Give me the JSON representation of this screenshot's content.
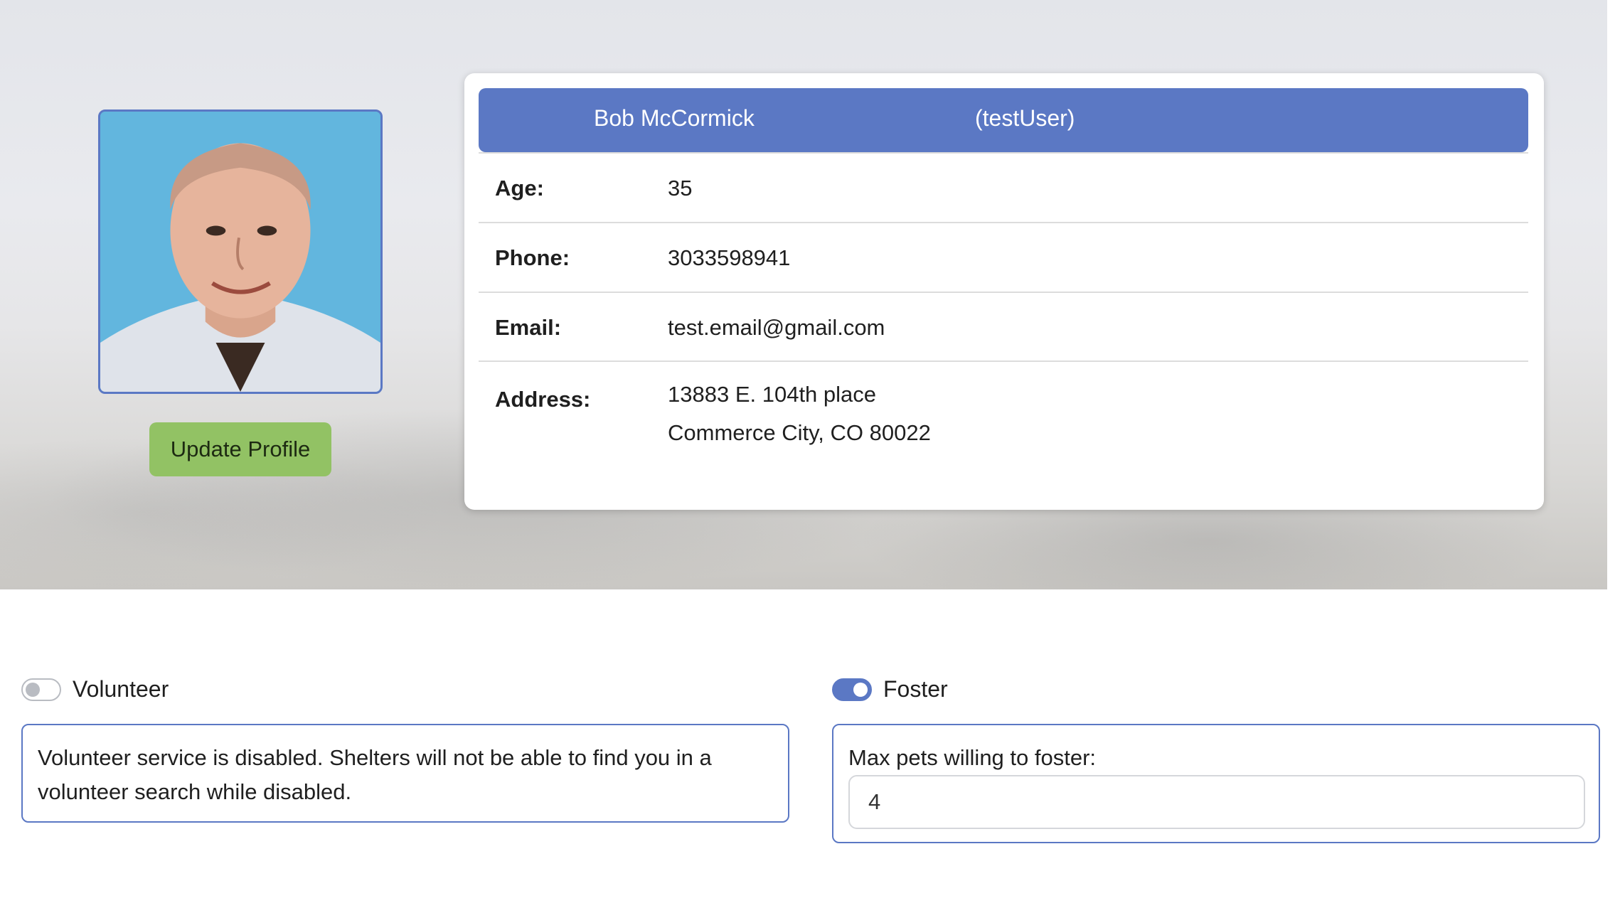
{
  "profile": {
    "update_button": "Update Profile",
    "name": "Bob McCormick",
    "username": "(testUser)",
    "rows": [
      {
        "label": "Age:",
        "value": "35"
      },
      {
        "label": "Phone:",
        "value": "3033598941"
      },
      {
        "label": "Email:",
        "value": "test.email@gmail.com"
      },
      {
        "label": "Address:",
        "line1": "13883 E. 104th place",
        "line2": "Commerce City, CO 80022"
      }
    ]
  },
  "volunteer": {
    "label": "Volunteer",
    "enabled": false,
    "message": "Volunteer service is disabled. Shelters will not be able to find you in a volunteer search while disabled."
  },
  "foster": {
    "label": "Foster",
    "enabled": true,
    "field_label": "Max pets willing to foster:",
    "field_value": "4"
  },
  "colors": {
    "accent": "#5b78c4",
    "button_green": "#92c264"
  }
}
